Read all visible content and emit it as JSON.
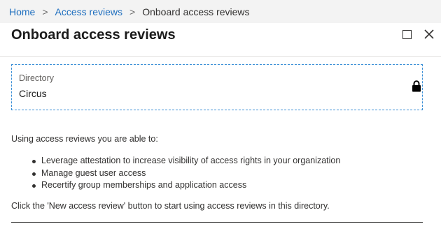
{
  "breadcrumb": {
    "items": [
      "Home",
      "Access reviews"
    ],
    "separator": ">",
    "current": "Onboard access reviews"
  },
  "header": {
    "title": "Onboard access reviews"
  },
  "directory": {
    "label": "Directory",
    "value": "Circus",
    "icon": "lock-icon"
  },
  "content": {
    "intro": "Using access reviews you are able to:",
    "bullets": [
      "Leverage attestation to increase visibility of access rights in your organization",
      "Manage guest user access",
      "Recertify group memberships and application access"
    ],
    "outro": "Click the 'New access review' button to start using access reviews in this directory."
  },
  "colors": {
    "link": "#1f6fbf",
    "focus_border": "#3a8fd6",
    "breadcrumb_bg": "#f3f3f3"
  }
}
